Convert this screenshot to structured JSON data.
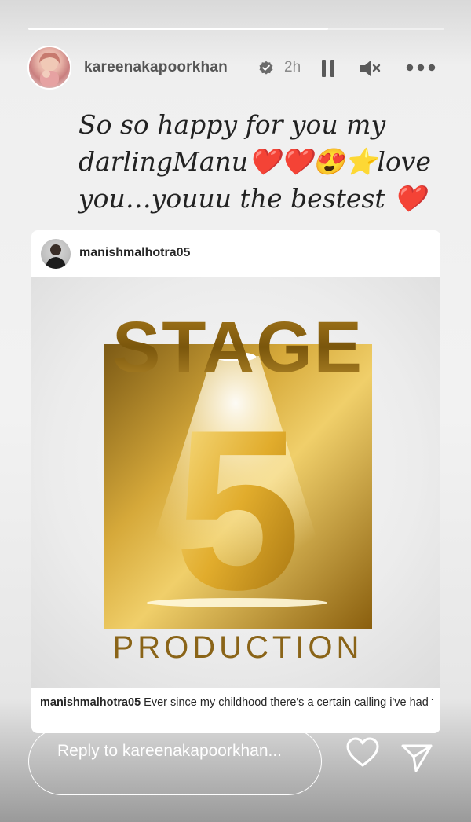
{
  "story": {
    "progress": 0.72,
    "username": "kareenakapoorkhan",
    "time": "2h",
    "verified": true,
    "caption_lines": [
      "So so happy for you my",
      "darlingManu❤️❤️😍⭐love",
      "you…youuu the bestest ❤️"
    ]
  },
  "shared_post": {
    "username": "manishmalhotra05",
    "poster": {
      "top_word": "STAGE",
      "number": "5",
      "bottom_word": "PRODUCTION"
    },
    "caption_user": "manishmalhotra05",
    "caption_text": "Ever since my childhood there's a certain calling i've had for Clothes , Colours and Films . I was fascinat..."
  },
  "reply": {
    "placeholder": "Reply to kareenakapoorkhan..."
  },
  "icons": {
    "pause": "pause-icon",
    "mute": "volume-muted-icon",
    "more": "more-options-icon",
    "like": "heart-icon",
    "share": "send-icon",
    "verified": "verified-badge-icon"
  },
  "colors": {
    "gold_light": "#f3d27a",
    "gold_dark": "#9c6a10",
    "verified_fill": "#6b6b6b"
  }
}
